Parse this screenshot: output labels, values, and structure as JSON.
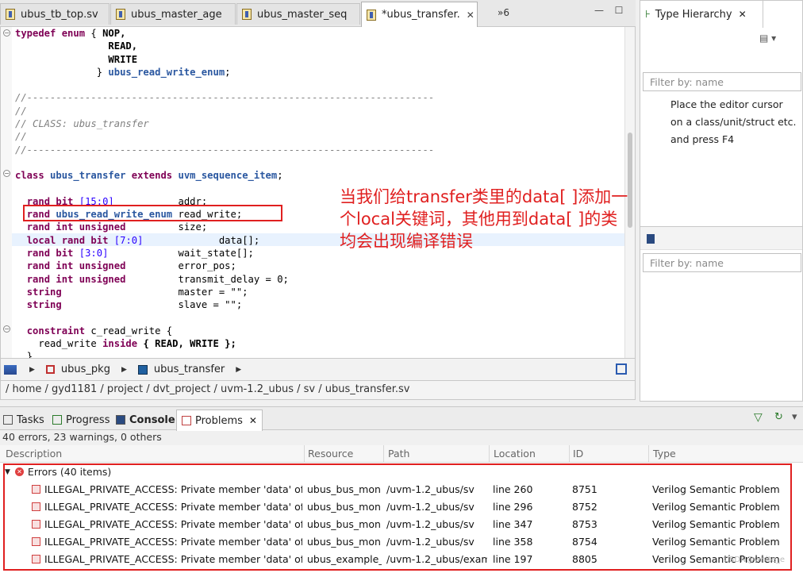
{
  "editor_tabs": [
    {
      "label": "ubus_tb_top.sv",
      "active": false
    },
    {
      "label": "ubus_master_age",
      "active": false
    },
    {
      "label": "ubus_master_seq",
      "active": false
    },
    {
      "label": "*ubus_transfer.",
      "active": true
    }
  ],
  "tab_overflow": "»6",
  "code": {
    "enum_decl": {
      "kw1": "typedef",
      "kw2": "enum",
      "v1": "NOP,",
      "v2": "READ,",
      "v3": "WRITE",
      "name": "ubus_read_write_enum"
    },
    "comment_dashes": "//----------------------------------------------------------------------",
    "comment_blank": "//",
    "comment_class": "// CLASS: ubus_transfer",
    "class_decl": {
      "kw": "class",
      "name": "ubus_transfer",
      "extends": "extends",
      "base": "uvm_sequence_item"
    },
    "members": [
      {
        "mods": "rand bit",
        "typ": "[15:0]",
        "name": "addr;"
      },
      {
        "mods": "rand",
        "typ": "ubus_read_write_enum",
        "name": "read_write;"
      },
      {
        "mods": "rand int unsigned",
        "typ": "",
        "name": "size;"
      },
      {
        "mods": "local rand bit",
        "typ": "[7:0]",
        "name": "data[];"
      },
      {
        "mods": "rand bit",
        "typ": "[3:0]",
        "name": "wait_state[];"
      },
      {
        "mods": "rand int unsigned",
        "typ": "",
        "name": "error_pos;"
      },
      {
        "mods": "rand int unsigned",
        "typ": "",
        "name": "transmit_delay = 0;"
      },
      {
        "mods": "string",
        "typ": "",
        "name": "master = \"\";"
      },
      {
        "mods": "string",
        "typ": "",
        "name": "slave = \"\";"
      }
    ],
    "constraint": {
      "kw": "constraint",
      "name": "c_read_write {",
      "body_a": "read_write",
      "body_kw": "inside",
      "body_b": "{ READ, WRITE };",
      "close": "}"
    }
  },
  "annotation": "当我们给transfer类里的data[ ]添加一个local关键词，其他用到data[ ]的类均会出现编译错误",
  "breadcrumb": {
    "pkg": "ubus_pkg",
    "cls": "ubus_transfer"
  },
  "file_path": "/ home / gyd1181 / project / dvt_project / uvm-1.2_ubus / sv / ubus_transfer.sv",
  "type_hierarchy": {
    "title": "Type Hierarchy",
    "filter_placeholder": "Filter by: name",
    "help_lines": [
      "Place the editor cursor",
      "on a class/unit/struct etc.",
      "and press F4"
    ],
    "filter2_placeholder": "Filter by: name"
  },
  "bottom_tabs": [
    {
      "label": "Tasks",
      "active": false
    },
    {
      "label": "Progress",
      "active": false
    },
    {
      "label": "Console",
      "active": false
    },
    {
      "label": "Problems",
      "active": true
    }
  ],
  "problems": {
    "summary": "40 errors, 23 warnings, 0 others",
    "columns": [
      "Description",
      "Resource",
      "Path",
      "Location",
      "ID",
      "Type"
    ],
    "group": "Errors (40 items)",
    "rows": [
      {
        "desc": "ILLEGAL_PRIVATE_ACCESS: Private member 'data' of",
        "resource": "ubus_bus_mon",
        "path": "/uvm-1.2_ubus/sv",
        "location": "line 260",
        "id": "8751",
        "type": "Verilog Semantic Problem"
      },
      {
        "desc": "ILLEGAL_PRIVATE_ACCESS: Private member 'data' of",
        "resource": "ubus_bus_mon",
        "path": "/uvm-1.2_ubus/sv",
        "location": "line 296",
        "id": "8752",
        "type": "Verilog Semantic Problem"
      },
      {
        "desc": "ILLEGAL_PRIVATE_ACCESS: Private member 'data' of",
        "resource": "ubus_bus_mon",
        "path": "/uvm-1.2_ubus/sv",
        "location": "line 347",
        "id": "8753",
        "type": "Verilog Semantic Problem"
      },
      {
        "desc": "ILLEGAL_PRIVATE_ACCESS: Private member 'data' of",
        "resource": "ubus_bus_mon",
        "path": "/uvm-1.2_ubus/sv",
        "location": "line 358",
        "id": "8754",
        "type": "Verilog Semantic Problem"
      },
      {
        "desc": "ILLEGAL_PRIVATE_ACCESS: Private member 'data' of",
        "resource": "ubus_example_",
        "path": "/uvm-1.2_ubus/exam",
        "location": "line 197",
        "id": "8805",
        "type": "Verilog Semantic Problem"
      }
    ]
  },
  "watermark": "CSDN@white_e"
}
